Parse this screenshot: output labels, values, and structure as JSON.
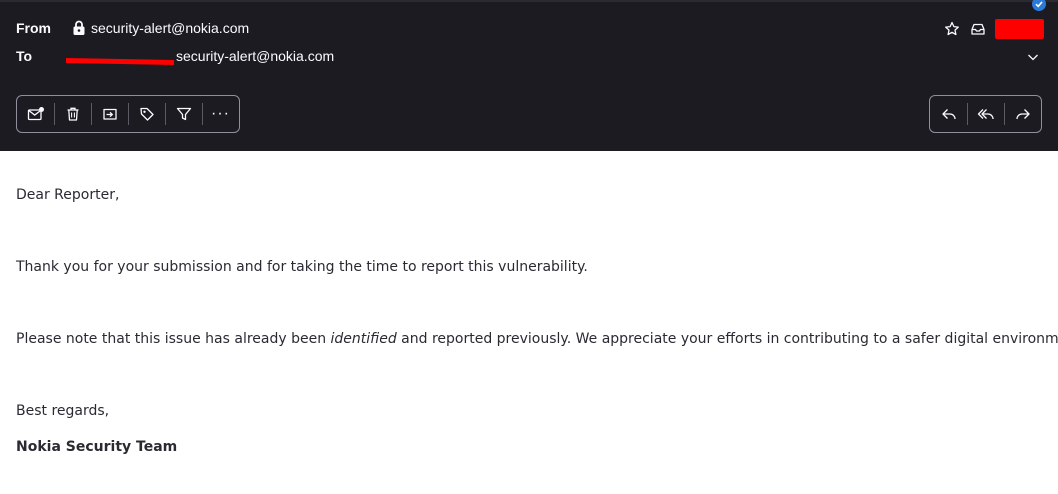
{
  "header": {
    "from_label": "From",
    "from_address": "security-alert@nokia.com",
    "to_label": "To",
    "to_address": "security-alert@nokia.com"
  },
  "icons": {
    "lock": "lock-icon",
    "star": "star-icon",
    "archive": "archive-icon",
    "chevron": "chevron-down-icon"
  },
  "toolbar": {
    "left": [
      "mark-unread",
      "delete",
      "move",
      "tag",
      "filter",
      "more"
    ],
    "right": [
      "reply",
      "reply-all",
      "forward"
    ],
    "more_label": "···"
  },
  "message": {
    "greeting": "Dear Reporter,",
    "thanks": "Thank you for your submission and for taking the time to report this vulnerability.",
    "note_before": "Please note that this issue has already been ",
    "note_emphasis": "identified",
    "note_after": " and reported previously. We appreciate your efforts in contributing to a safer digital environment.",
    "regards": "Best regards,",
    "signature": "Nokia Security Team"
  },
  "colors": {
    "header_bg": "#1c1b22",
    "header_text": "#fbfbfe",
    "redaction": "#ff0000",
    "badge": "#2a7bd8",
    "body_text": "#2b2a33"
  }
}
